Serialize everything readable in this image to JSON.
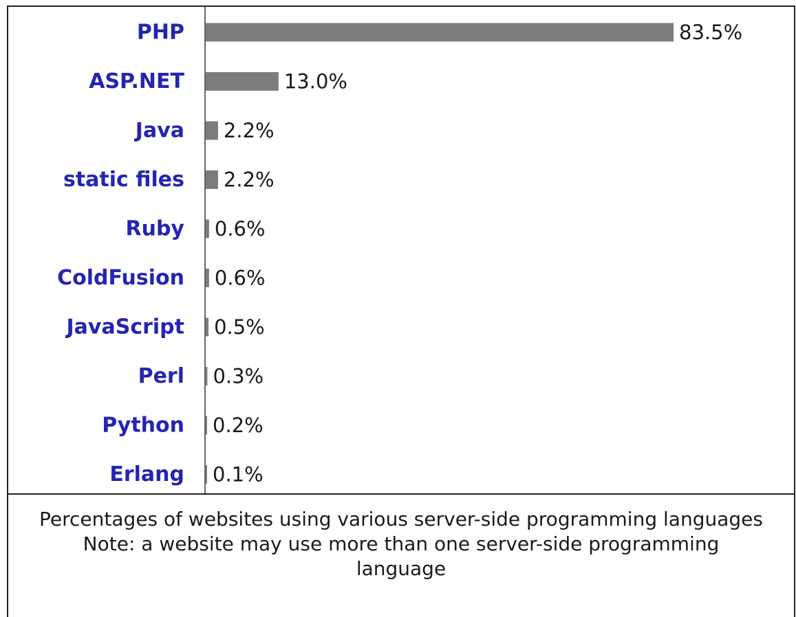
{
  "chart_data": {
    "type": "bar",
    "orientation": "horizontal",
    "categories": [
      "PHP",
      "ASP.NET",
      "Java",
      "static files",
      "Ruby",
      "ColdFusion",
      "JavaScript",
      "Perl",
      "Python",
      "Erlang"
    ],
    "values": [
      83.5,
      13.0,
      2.2,
      2.2,
      0.6,
      0.6,
      0.5,
      0.3,
      0.2,
      0.1
    ],
    "value_labels": [
      "83.5%",
      "13.0%",
      "2.2%",
      "2.2%",
      "0.6%",
      "0.6%",
      "0.5%",
      "0.3%",
      "0.2%",
      "0.1%"
    ],
    "unit": "%",
    "xlim": [
      0,
      83.5
    ],
    "grid": false,
    "legend": "none",
    "colors": {
      "bar": "#7c7c7c",
      "category_label": "#2525b0",
      "value_label": "#1a1a1a",
      "border": "#222222"
    }
  },
  "caption": {
    "line1": "Percentages of websites using various server-side programming languages",
    "line2": "Note: a website may use more than one server-side programming language"
  }
}
